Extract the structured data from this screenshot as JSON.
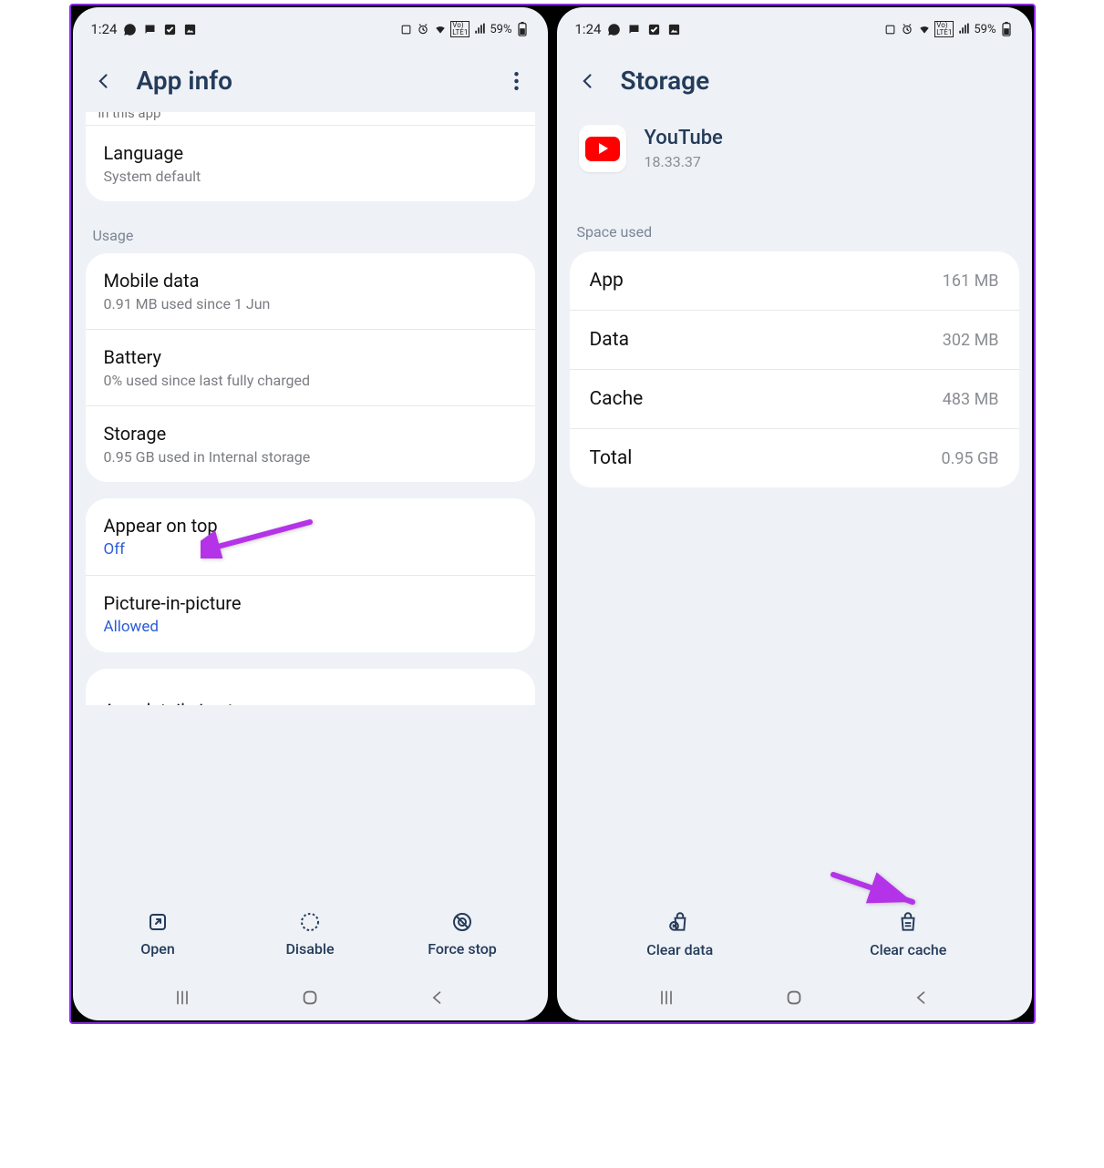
{
  "status": {
    "time": "1:24",
    "battery": "59%"
  },
  "left": {
    "title": "App info",
    "cutoff": "in this app",
    "language": {
      "title": "Language",
      "sub": "System default"
    },
    "usage_label": "Usage",
    "mobile": {
      "title": "Mobile data",
      "sub": "0.91 MB used since 1 Jun"
    },
    "battery": {
      "title": "Battery",
      "sub": "0% used since last fully charged"
    },
    "storage": {
      "title": "Storage",
      "sub": "0.95 GB used in Internal storage"
    },
    "appear": {
      "title": "Appear on top",
      "sub": "Off"
    },
    "pip": {
      "title": "Picture-in-picture",
      "sub": "Allowed"
    },
    "cut_bottom": "App details in store",
    "actions": {
      "open": "Open",
      "disable": "Disable",
      "force": "Force stop"
    }
  },
  "right": {
    "title": "Storage",
    "app_name": "YouTube",
    "app_version": "18.33.37",
    "space_label": "Space used",
    "rows": {
      "app": {
        "label": "App",
        "value": "161 MB"
      },
      "data": {
        "label": "Data",
        "value": "302 MB"
      },
      "cache": {
        "label": "Cache",
        "value": "483 MB"
      },
      "total": {
        "label": "Total",
        "value": "0.95 GB"
      }
    },
    "actions": {
      "clear_data": "Clear data",
      "clear_cache": "Clear cache"
    }
  }
}
